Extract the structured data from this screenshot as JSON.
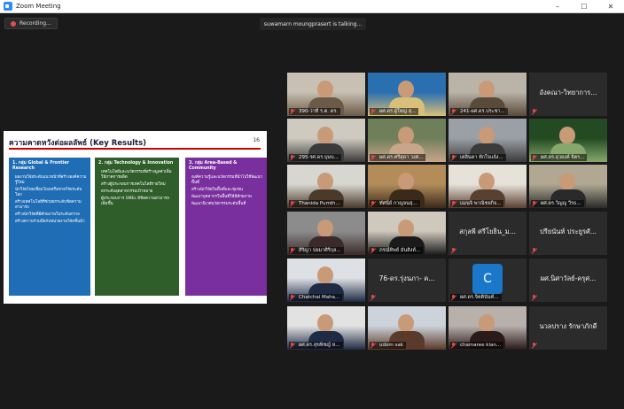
{
  "window": {
    "title": "Zoom Meeting",
    "controls": [
      "–",
      "☐",
      "✕"
    ]
  },
  "recording": {
    "label": "Recording...",
    "icon": "record-dot-icon"
  },
  "speaker_banner": "suwamarn moungprasert is talking...",
  "slide": {
    "title": "ความคาดหวังต่อผลลัพธ์ (Key Results)",
    "page_number": "16",
    "columns": [
      {
        "heading": "1. กลุ่ม Global & Frontier Research",
        "bullets": [
          "ผลงานวิจัยระดับแนวหน้าที่สร้างองค์ความรู้ใหม่",
          "นักวิจัยไทยเชื่อมโยงเครือข่ายวิจัยระดับโลก",
          "สร้างเทคโนโลยีที่ช่วยยกระดับขีดความสามารถ",
          "สร้างนักวิจัยที่มีศักยภาพในระดับสากล",
          "สร้างความร่วมมือกับหน่วยงานวิจัยชั้นนำ"
        ]
      },
      {
        "heading": "2. กลุ่ม Technology & Innovation",
        "bullets": [
          "เทคโนโลยีและนวัตกรรมที่สร้างมูลค่าเพิ่มให้ภาคการผลิต",
          "สร้างผู้ประกอบการเทคโนโลยีรายใหม่",
          "ยกระดับอุตสาหกรรมเป้าหมาย",
          "ผู้ประกอบการ SMEs มีขีดความสามารถเพิ่มขึ้น"
        ]
      },
      {
        "heading": "3. กลุ่ม Area-Based & Community",
        "bullets": [
          "องค์ความรู้และนวัตกรรมที่นำไปใช้พัฒนาพื้นที่",
          "สร้างนักวิจัยในพื้นที่และชุมชน",
          "พัฒนาบุคลากรในพื้นที่ให้มีศักยภาพ",
          "พัฒนานิเวศนวัตกรรมระดับพื้นที่"
        ]
      }
    ]
  },
  "participants": [
    {
      "name": "390-ว่าที่ ร.ต. ดร.",
      "muted": true,
      "video": true
    },
    {
      "name": "ผศ.ดร.ผู้ใหญ่ สุ...",
      "muted": true,
      "video": true
    },
    {
      "name": "241-ผศ.ดร.ประชา...",
      "muted": true,
      "video": true
    },
    {
      "name": "อังคณา-วิทยาการ...",
      "muted": true,
      "video": false
    },
    {
      "name": "295-รศ.ดร.บุษบ...",
      "muted": true,
      "video": true
    },
    {
      "name": "ผศ.ดร.ศรีสุดา วงศ...",
      "muted": true,
      "video": true
    },
    {
      "name": "เคลินดา ทักใจแจ้ง...",
      "muted": true,
      "video": true
    },
    {
      "name": "ผศ.ดร.ยุวยงค์ จิตร...",
      "muted": true,
      "video": true
    },
    {
      "name": "Thanida Pumth...",
      "muted": true,
      "video": true
    },
    {
      "name": "ทัศนีย์ กาญจนสุ...",
      "muted": true,
      "video": true
    },
    {
      "name": "แมนจิ พาณิชยกิจ...",
      "muted": true,
      "video": true
    },
    {
      "name": "ผศ.ดร.วิญญู วีรธ...",
      "muted": true,
      "video": true
    },
    {
      "name": "สิริญา ปยมาศิริกุล...",
      "muted": true,
      "video": true
    },
    {
      "name": "ภรณ์ทิพย์ มั่นสิงห์...",
      "muted": true,
      "video": true,
      "active": true
    },
    {
      "name": "สกุลพี ศรีโยธิน_ม...",
      "muted": true,
      "video": false
    },
    {
      "name": "ปรียนันท์ ประยูรศั...",
      "muted": true,
      "video": false
    },
    {
      "name": "Chatchai Maha...",
      "muted": true,
      "video": true
    },
    {
      "name": "76-ดร.รุ่งนภา- ค...",
      "muted": true,
      "video": false
    },
    {
      "name": "ผศ.ดร.จิตตินันท์...",
      "muted": true,
      "video": false,
      "avatar_letter": "C"
    },
    {
      "name": "ผศ.นิศาวัลย์-ครุศ...",
      "muted": true,
      "video": false
    },
    {
      "name": "ผศ.ดร.สุขพิชญ์ ห...",
      "muted": true,
      "video": true
    },
    {
      "name": "udom sak",
      "muted": true,
      "video": true
    },
    {
      "name": "chamaree klan...",
      "muted": true,
      "video": true
    },
    {
      "name": "นวลปราง รักษาภักดี",
      "muted": true,
      "video": false
    }
  ],
  "colors": {
    "background": "#1a1a1a",
    "tile": "#2b2b2b",
    "muted_mic": "#e54848",
    "active_speaker": "#8fd14f",
    "zoom_blue": "#2d8cff"
  }
}
